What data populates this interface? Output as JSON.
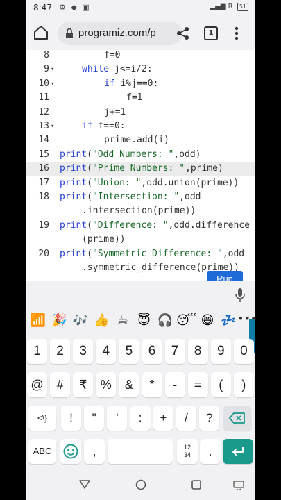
{
  "status": {
    "time": "8:47",
    "battery": "51",
    "signal_text": "R"
  },
  "browser": {
    "url": "programiz.com/p",
    "tab_count": "1"
  },
  "code_lines": [
    {
      "num": "8",
      "fold": "",
      "indent": 2,
      "text": "f=0"
    },
    {
      "num": "9",
      "fold": "▾",
      "indent": 1,
      "text": "while j<=i/2:"
    },
    {
      "num": "10",
      "fold": "▾",
      "indent": 2,
      "text": "if i%j==0:"
    },
    {
      "num": "11",
      "fold": "",
      "indent": 3,
      "text": "f=1"
    },
    {
      "num": "12",
      "fold": "",
      "indent": 2,
      "text": "j+=1"
    },
    {
      "num": "13",
      "fold": "▾",
      "indent": 1,
      "text": "if f==0:"
    },
    {
      "num": "14",
      "fold": "",
      "indent": 2,
      "text": "prime.add(i)"
    },
    {
      "num": "15",
      "fold": "",
      "indent": 0,
      "text": "print(\"Odd Numbers: \",odd)"
    },
    {
      "num": "16",
      "fold": "",
      "indent": 0,
      "text": "print(\"Prime Numbers: \",prime)"
    },
    {
      "num": "17",
      "fold": "",
      "indent": 0,
      "text": "print(\"Union: \",odd.union(prime))"
    },
    {
      "num": "18",
      "fold": "",
      "indent": 0,
      "text": "print(\"Intersection: \",odd"
    },
    {
      "num": "",
      "fold": "",
      "indent": 1,
      "text": ".intersection(prime))"
    },
    {
      "num": "19",
      "fold": "",
      "indent": 0,
      "text": "print(\"Difference: \",odd.difference"
    },
    {
      "num": "",
      "fold": "",
      "indent": 1,
      "text": "(prime))"
    },
    {
      "num": "20",
      "fold": "",
      "indent": 0,
      "text": "print(\"Symmetric Difference: \",odd"
    },
    {
      "num": "",
      "fold": "",
      "indent": 1,
      "text": ".symmetric_difference(prime))"
    }
  ],
  "active_line_index": 8,
  "run_label": "Run",
  "emojis": [
    "📶",
    "🎉",
    "🎶",
    "👍",
    "☕",
    "😇",
    "🎧",
    "😴",
    "😄",
    "💤"
  ],
  "emoji_more": "•••",
  "keyboard": {
    "numbers": [
      "1",
      "2",
      "3",
      "4",
      "5",
      "6",
      "7",
      "8",
      "9",
      "0"
    ],
    "symbols": [
      "@",
      "#",
      "₹",
      "%",
      "&",
      "*",
      "-",
      "=",
      "(",
      ")"
    ],
    "row3": [
      "<\\}",
      "!",
      "\"",
      "'",
      ":",
      "+",
      "/",
      "?"
    ],
    "abc": "ABC",
    "comma": ",",
    "numpad": "12\n34",
    "period": "."
  },
  "colors": {
    "accent": "#1a9a8a",
    "run_button": "#1e6ad8",
    "keyword": "#2743d4",
    "string": "#1a6a2a"
  }
}
